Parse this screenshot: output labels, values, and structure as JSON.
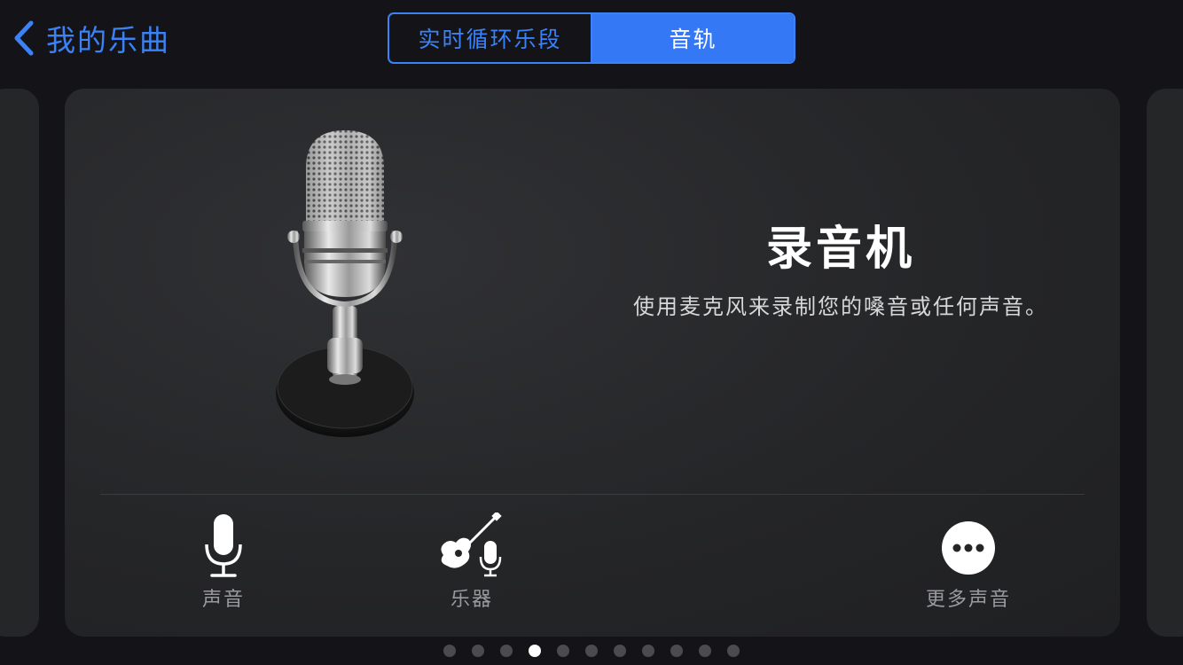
{
  "nav": {
    "back_label": "我的乐曲",
    "tabs": [
      {
        "label": "实时循环乐段",
        "active": false
      },
      {
        "label": "音轨",
        "active": true
      }
    ]
  },
  "card": {
    "title": "录音机",
    "description": "使用麦克风来录制您的嗓音或任何声音。",
    "options": [
      {
        "label": "声音",
        "icon": "microphone-icon"
      },
      {
        "label": "乐器",
        "icon": "guitar-microphone-icon"
      },
      {
        "label": "更多声音",
        "icon": "more-icon"
      }
    ]
  },
  "pagination": {
    "total": 11,
    "current": 4
  },
  "colors": {
    "accent": "#3478f6",
    "background": "#141418",
    "card": "#242527"
  }
}
